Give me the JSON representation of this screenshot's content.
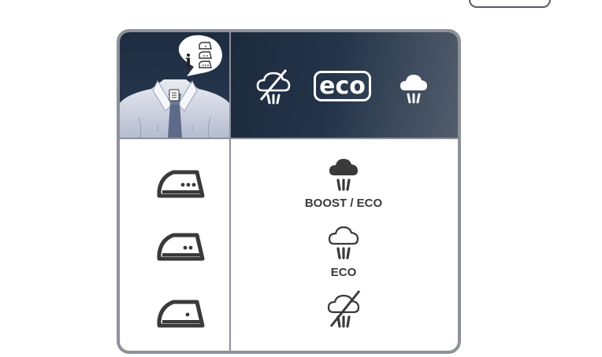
{
  "header": {
    "info_glyph": "i",
    "eco_badge_text": "eco"
  },
  "settings": [
    {
      "iron_dots": 3,
      "steam_mode": "boost-eco",
      "label": "BOOST / ECO"
    },
    {
      "iron_dots": 2,
      "steam_mode": "eco",
      "label": "ECO"
    },
    {
      "iron_dots": 1,
      "steam_mode": "no-steam",
      "label": ""
    }
  ],
  "colors": {
    "header_dark": "#1d2c40",
    "border_gray": "#8d9299",
    "icon_dark": "#3a3a3a",
    "header_icon": "#ffffff"
  }
}
